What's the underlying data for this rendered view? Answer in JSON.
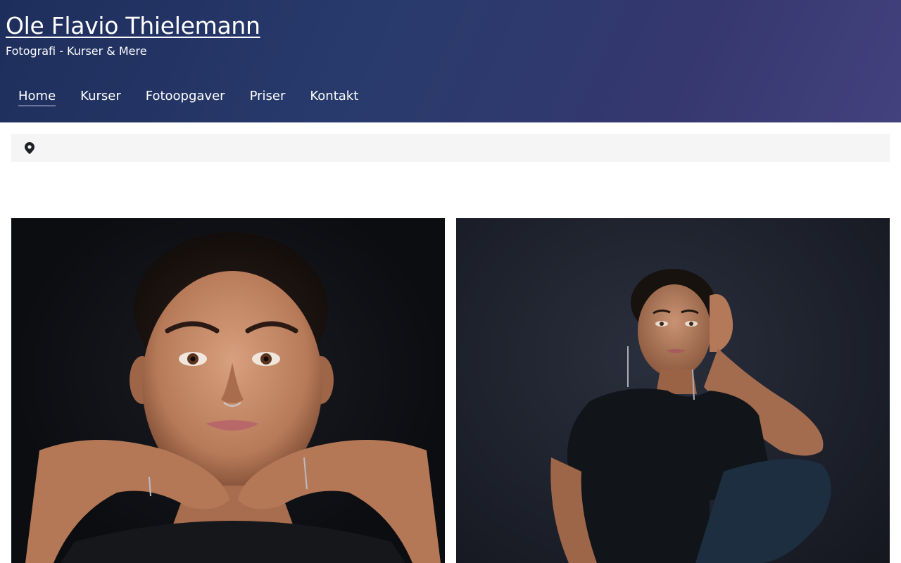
{
  "site": {
    "title": "Ole Flavio Thielemann",
    "tagline": "Fotografi - Kurser & Mere"
  },
  "nav": {
    "items": [
      {
        "label": "Home",
        "active": true
      },
      {
        "label": "Kurser",
        "active": false
      },
      {
        "label": "Fotoopgaver",
        "active": false
      },
      {
        "label": "Priser",
        "active": false
      },
      {
        "label": "Kontakt",
        "active": false
      }
    ]
  },
  "breadcrumb": {
    "icon": "location-pin-icon"
  },
  "gallery": {
    "images": [
      {
        "name": "portrait-photo-hands-under-chin"
      },
      {
        "name": "portrait-photo-seated-hand-on-head"
      }
    ]
  },
  "colors": {
    "header_gradient_start": "#1e2e5c",
    "header_gradient_end": "#43417e",
    "breadcrumb_bg": "#f5f5f5"
  }
}
